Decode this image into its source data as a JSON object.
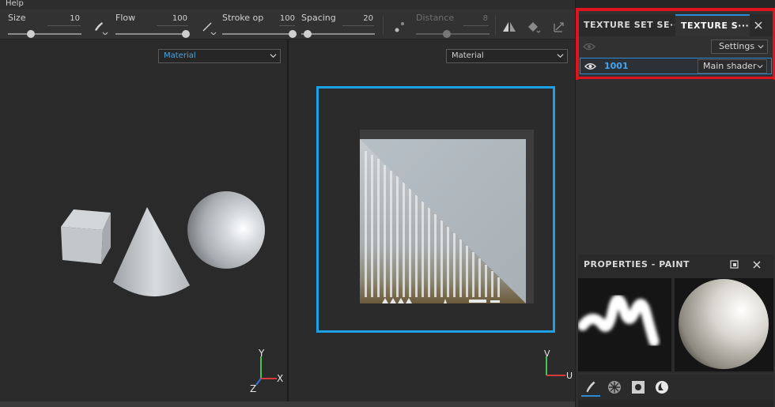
{
  "menu": {
    "help": "Help"
  },
  "toolbar": {
    "size": {
      "label": "Size",
      "value": "10",
      "fill": 0.1
    },
    "flow": {
      "label": "Flow",
      "value": "100",
      "fill": 1.0
    },
    "stroke_opacity": {
      "label": "Stroke op",
      "value": "100",
      "fill": 1.0
    },
    "spacing": {
      "label": "Spacing",
      "value": "20",
      "fill": 0.2
    },
    "distance": {
      "label": "Distance",
      "value": "8",
      "fill": 0.5,
      "disabled": true
    },
    "icons": [
      "brush-alignment-icon",
      "stroke-line-icon",
      "lazy-mouse-icon",
      "symmetry-icon",
      "fill-projection-icon",
      "tangent-icon"
    ]
  },
  "viewport_3d": {
    "channel": "Material",
    "axes": {
      "y": "Y",
      "x": "X",
      "z": "Z"
    }
  },
  "viewport_2d": {
    "channel": "Material",
    "axes": {
      "v": "V",
      "u": "U"
    }
  },
  "texture_set_panel": {
    "tabs": [
      "TEXTURE SET SE···",
      "TEXTURE S···"
    ],
    "settings_label": "Settings",
    "rows": [
      {
        "name": "1001",
        "shader": "Main shader"
      }
    ],
    "highlight_color": "#e0141e",
    "accent_color": "#2a8ad4"
  },
  "properties_panel": {
    "title": "PROPERTIES - PAINT",
    "tab_icons": [
      "brush-icon",
      "alpha-icon",
      "stencil-icon",
      "material-icon"
    ]
  }
}
